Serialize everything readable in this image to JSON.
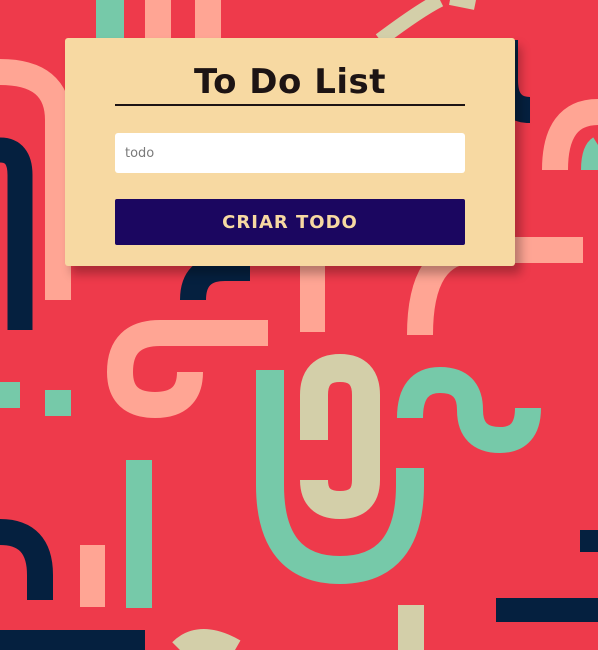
{
  "card": {
    "title": "To Do List",
    "input_placeholder": "todo",
    "input_value": "",
    "button_label": "CRIAR TODO"
  },
  "colors": {
    "background": "#ee3a4b",
    "card": "#f7d9a2",
    "button": "#1b0660",
    "shape_salmon": "#ffa594",
    "shape_mint": "#76c9a9",
    "shape_navy": "#05203f",
    "shape_sand": "#d3cfa9"
  }
}
